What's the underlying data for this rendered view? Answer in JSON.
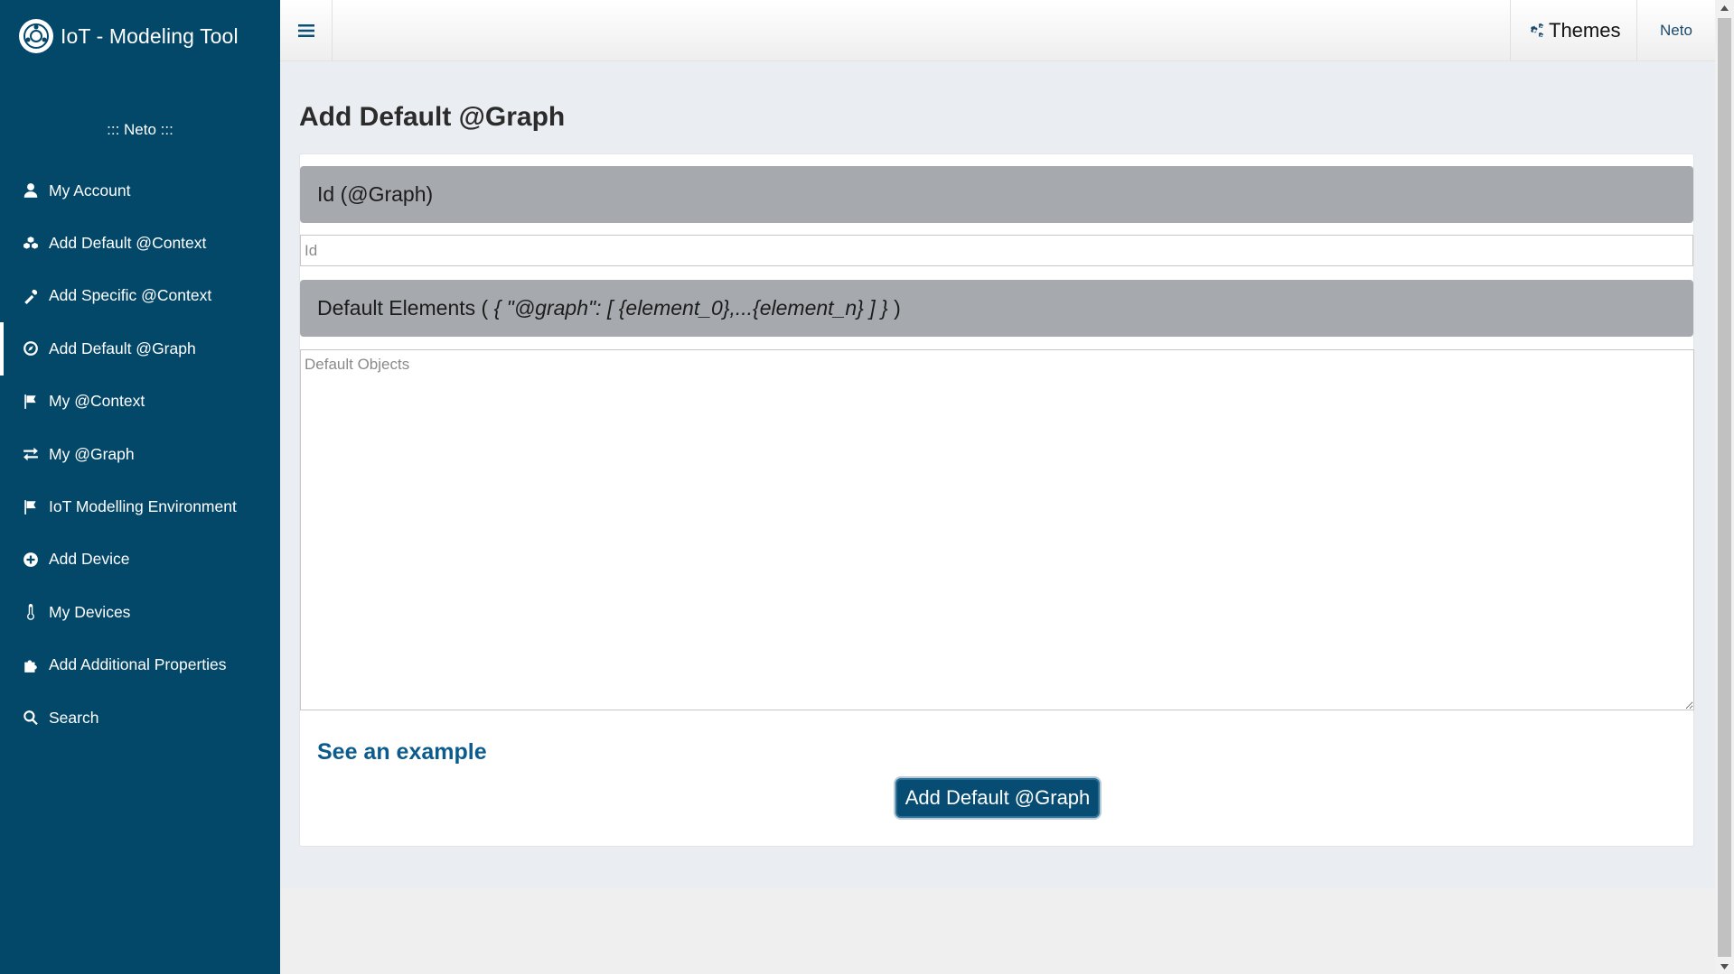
{
  "app": {
    "title": "IoT - Modeling Tool",
    "logo_icon": "logo-icon"
  },
  "sidebar": {
    "user_label": "::: Neto :::",
    "items": [
      {
        "label": "My Account",
        "icon": "user-icon"
      },
      {
        "label": "Add Default @Context",
        "icon": "cubes-icon"
      },
      {
        "label": "Add Specific @Context",
        "icon": "tools-icon"
      },
      {
        "label": "Add Default @Graph",
        "icon": "compass-icon",
        "active": true
      },
      {
        "label": "My @Context",
        "icon": "flag-icon"
      },
      {
        "label": "My @Graph",
        "icon": "exchange-icon"
      },
      {
        "label": "IoT Modelling Environment",
        "icon": "flag-icon"
      },
      {
        "label": "Add Device",
        "icon": "plus-circle-icon"
      },
      {
        "label": "My Devices",
        "icon": "thermometer-icon"
      },
      {
        "label": "Add Additional Properties",
        "icon": "puzzle-icon"
      },
      {
        "label": "Search",
        "icon": "search-icon"
      }
    ]
  },
  "topbar": {
    "menu_icon": "hamburger-icon",
    "themes_label": "Themes",
    "themes_icon": "gears-icon",
    "user_name": "Neto"
  },
  "main": {
    "page_title": "Add Default @Graph",
    "id_section": {
      "header": "Id (@Graph)",
      "placeholder": "Id",
      "value": ""
    },
    "elements_section": {
      "header_prefix": "Default Elements ( ",
      "header_code": "{ \"@graph\": [ {element_0},...{element_n} ] }",
      "header_suffix": " )",
      "placeholder": "Default Objects",
      "value": ""
    },
    "example_link": "See an example",
    "submit_label": "Add Default @Graph"
  },
  "colors": {
    "sidebar_bg": "#034769",
    "section_header_bg": "#a6a9ae",
    "link": "#0c5b8d",
    "button_bg": "#064c73"
  }
}
